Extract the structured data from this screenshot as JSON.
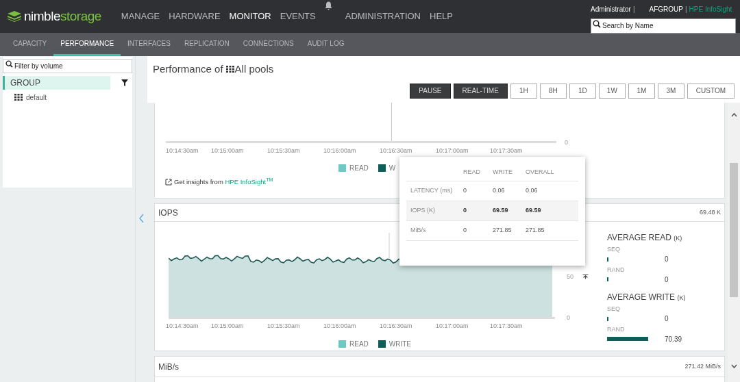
{
  "logo": {
    "brand": "nimble",
    "suffix": "storage"
  },
  "nav": [
    {
      "label": "MANAGE",
      "selected": false
    },
    {
      "label": "HARDWARE",
      "selected": false
    },
    {
      "label": "MONITOR",
      "selected": true
    },
    {
      "label": "EVENTS",
      "selected": false
    },
    {
      "label": "ADMINISTRATION",
      "selected": false
    },
    {
      "label": "HELP",
      "selected": false
    }
  ],
  "user": {
    "name": "Administrator",
    "separator_1": "|",
    "group": "AFGROUP",
    "separator_2": "|",
    "link": "HPE InfoSight"
  },
  "search": {
    "placeholder": "Search by Name"
  },
  "subnav": [
    {
      "label": "CAPACITY",
      "selected": false
    },
    {
      "label": "PERFORMANCE",
      "selected": true
    },
    {
      "label": "INTERFACES",
      "selected": false
    },
    {
      "label": "REPLICATION",
      "selected": false
    },
    {
      "label": "CONNECTIONS",
      "selected": false
    },
    {
      "label": "AUDIT LOG",
      "selected": false
    }
  ],
  "sidebar": {
    "filter": {
      "placeholder": "Filter by volume"
    },
    "group": {
      "label": "GROUP",
      "selected": true
    },
    "items": [
      {
        "label": "default"
      }
    ]
  },
  "page_title": {
    "prefix": "Performance of",
    "scope": "All pools"
  },
  "time_buttons": [
    {
      "label": "PAUSE",
      "active": true
    },
    {
      "label": "REAL-TIME",
      "active": true
    },
    {
      "label": "1H",
      "active": false
    },
    {
      "label": "8H",
      "active": false
    },
    {
      "label": "1D",
      "active": false
    },
    {
      "label": "1W",
      "active": false
    },
    {
      "label": "1M",
      "active": false
    },
    {
      "label": "3M",
      "active": false
    },
    {
      "label": "CUSTOM",
      "active": false
    }
  ],
  "latency_panel": {
    "y_labels": [
      "0"
    ],
    "x_labels": [
      "10:14:30am",
      "10:15:00am",
      "10:15:30am",
      "10:16:00am",
      "10:16:30am",
      "10:17:00am",
      "10:17:30am"
    ],
    "legend": [
      {
        "label": "READ",
        "color": "#6ec9c3"
      },
      {
        "label": "W",
        "color": "#0e5f58"
      }
    ],
    "link": {
      "prefix": "Get insights from",
      "label": "HPE InfoSight$^{TM}$"
    }
  },
  "iops_panel": {
    "title": "IOPS",
    "total": "69.48 K",
    "y_labels": [
      "50",
      "0"
    ],
    "x_labels": [
      "10:14:30am",
      "10:15:00am",
      "10:15:30am",
      "10:16:00am",
      "10:16:30am",
      "10:17:00am",
      "10:17:30am"
    ],
    "legend": [
      {
        "label": "READ",
        "color": "#6ec9c3"
      },
      {
        "label": "WRITE",
        "color": "#0e5f58"
      }
    ],
    "stats": [
      {
        "title": "AVERAGE READ",
        "unit": "(K)",
        "rows": [
          {
            "label": "SEQ",
            "value": "0",
            "level": 0
          },
          {
            "label": "RAND",
            "value": "0",
            "level": 0
          }
        ]
      },
      {
        "title": "AVERAGE WRITE",
        "unit": "(K)",
        "rows": [
          {
            "label": "SEQ",
            "value": "0",
            "level": 0
          },
          {
            "label": "RAND",
            "value": "70.39",
            "level": 0.8
          }
        ]
      }
    ]
  },
  "throughput_panel": {
    "title": "MiB/s",
    "total": "271.42 MiB/s"
  },
  "tooltip": {
    "columns": [
      "READ",
      "WRITE",
      "OVERALL"
    ],
    "rows": [
      {
        "label": "LATENCY (ms)",
        "values": [
          "0",
          "0.06",
          "0.06"
        ],
        "highlighted": false
      },
      {
        "label": "IOPS (K)",
        "values": [
          "0",
          "69.59",
          "69.59"
        ],
        "highlighted": true
      },
      {
        "label": "MiB/s",
        "values": [
          "0",
          "271.85",
          "271.85"
        ],
        "highlighted": false
      }
    ]
  }
}
